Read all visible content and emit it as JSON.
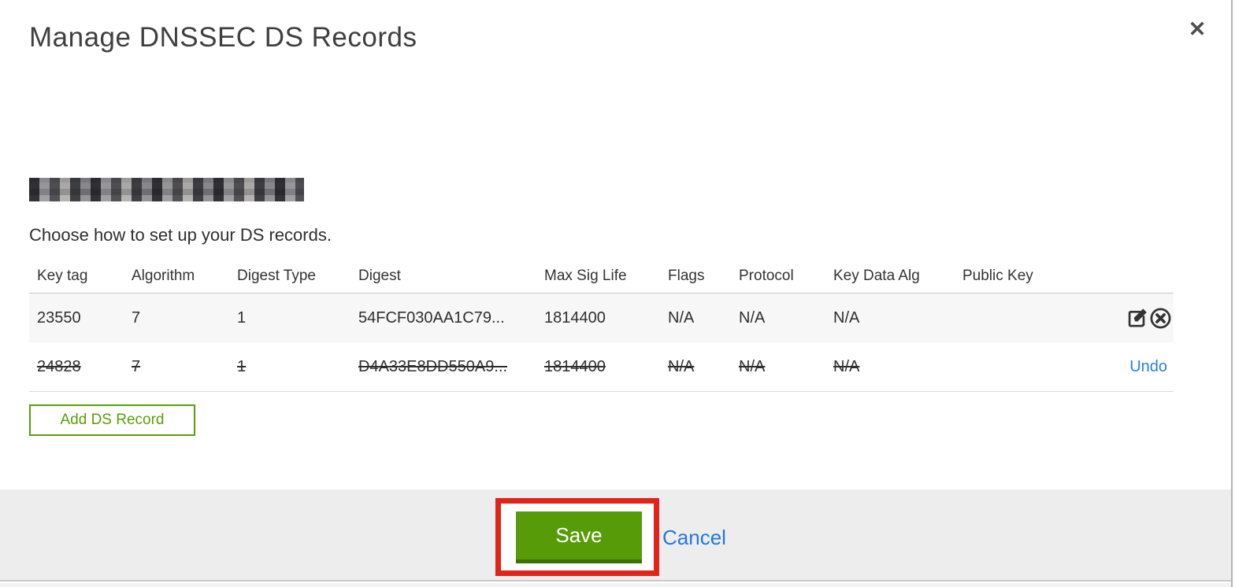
{
  "dialog": {
    "title": "Manage DNSSEC DS Records",
    "close_icon": "close",
    "instruction": "Choose how to set up your DS records.",
    "domain_redacted": true
  },
  "table": {
    "columns": [
      "Key tag",
      "Algorithm",
      "Digest Type",
      "Digest",
      "Max Sig Life",
      "Flags",
      "Protocol",
      "Key Data Alg",
      "Public Key"
    ],
    "rows": [
      {
        "key_tag": "23550",
        "algorithm": "7",
        "digest_type": "1",
        "digest": "54FCF030AA1C79...",
        "max_sig_life": "1814400",
        "flags": "N/A",
        "protocol": "N/A",
        "key_data_alg": "N/A",
        "public_key": "",
        "deleted": false,
        "actions": [
          "edit-icon",
          "delete-icon"
        ]
      },
      {
        "key_tag": "24828",
        "algorithm": "7",
        "digest_type": "1",
        "digest": "D4A33E8DD550A9...",
        "max_sig_life": "1814400",
        "flags": "N/A",
        "protocol": "N/A",
        "key_data_alg": "N/A",
        "public_key": "",
        "deleted": true,
        "undo_label": "Undo"
      }
    ]
  },
  "buttons": {
    "add_ds_record": "Add DS Record",
    "save": "Save",
    "cancel": "Cancel"
  },
  "colors": {
    "accent_green": "#579b08",
    "accent_green_dark": "#3f7007",
    "outline_green": "#5a9e08",
    "link_blue": "#2277e2",
    "annotation_red": "#e0241a",
    "footer_gray": "#ededed",
    "row_alt_gray": "#f7f7f7"
  }
}
